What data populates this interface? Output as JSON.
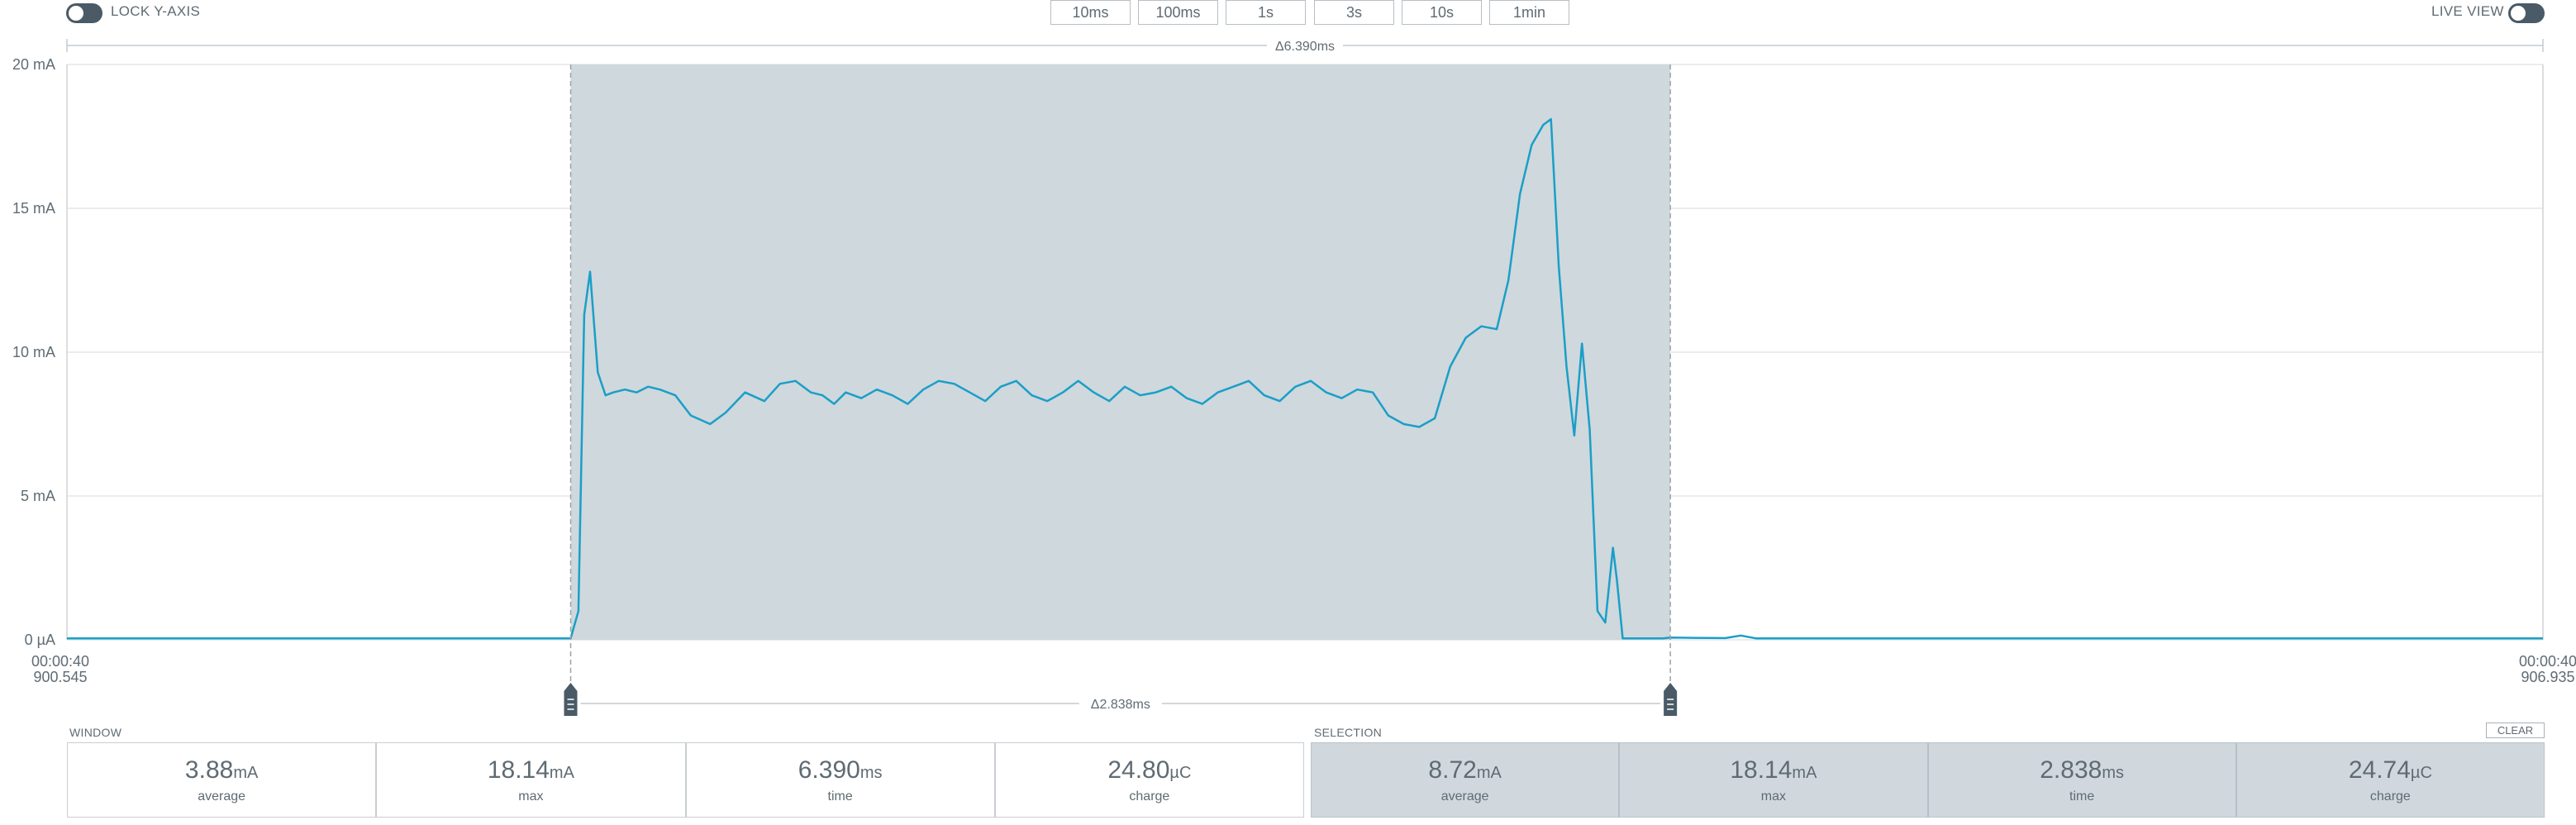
{
  "toolbar": {
    "lock_label": "LOCK Y-AXIS",
    "live_label": "LIVE VIEW",
    "windows": [
      "10ms",
      "100ms",
      "1s",
      "3s",
      "10s",
      "1min"
    ]
  },
  "colors": {
    "line": "#1a9fc7",
    "selection": "#cfd8dd",
    "grid": "#e3e6e8",
    "text": "#5f6b73",
    "marker": "#4a5a66"
  },
  "chart_data": {
    "type": "line",
    "x_unit": "ms",
    "xlim": [
      0,
      6.39
    ],
    "ylim": [
      0,
      20
    ],
    "y_ticks": [
      0,
      5,
      10,
      15,
      20
    ],
    "y_tick_labels": [
      "0 µA",
      "5 mA",
      "10 mA",
      "15 mA",
      "20 mA"
    ],
    "x_start_label": {
      "line1": "00:00:40",
      "line2": "900.545"
    },
    "x_end_label": {
      "line1": "00:00:40",
      "line2": "906.935"
    },
    "window_delta_label": "Δ6.390ms",
    "selection": {
      "start": 1.3,
      "end": 4.138,
      "delta_label": "Δ2.838ms"
    },
    "grid": true,
    "series": [
      {
        "x": [
          0,
          1.3,
          1.32,
          1.335,
          1.35,
          1.37,
          1.39,
          1.41,
          1.44,
          1.47,
          1.5,
          1.53,
          1.57,
          1.61,
          1.66,
          1.7,
          1.75,
          1.8,
          1.84,
          1.88,
          1.92,
          1.95,
          1.98,
          2.01,
          2.05,
          2.09,
          2.13,
          2.17,
          2.21,
          2.25,
          2.29,
          2.33,
          2.37,
          2.41,
          2.45,
          2.49,
          2.53,
          2.57,
          2.61,
          2.65,
          2.69,
          2.73,
          2.77,
          2.81,
          2.85,
          2.89,
          2.93,
          2.97,
          3.01,
          3.05,
          3.09,
          3.13,
          3.17,
          3.21,
          3.25,
          3.29,
          3.33,
          3.37,
          3.41,
          3.45,
          3.49,
          3.53,
          3.57,
          3.61,
          3.65,
          3.69,
          3.72,
          3.75,
          3.78,
          3.81,
          3.83,
          3.85,
          3.87,
          3.89,
          3.91,
          3.93,
          3.95,
          3.97,
          3.99,
          4.0,
          4.015,
          4.03,
          4.045,
          4.06,
          4.075,
          4.09,
          4.105,
          4.12,
          4.138,
          4.2,
          4.28,
          4.32,
          4.36,
          4.4,
          4.5,
          6.39
        ],
        "values": [
          0.05,
          0.05,
          1.0,
          11.3,
          12.8,
          9.3,
          8.5,
          8.6,
          8.7,
          8.6,
          8.8,
          8.7,
          8.5,
          7.8,
          7.5,
          7.9,
          8.6,
          8.3,
          8.9,
          9.0,
          8.6,
          8.5,
          8.2,
          8.6,
          8.4,
          8.7,
          8.5,
          8.2,
          8.7,
          9.0,
          8.9,
          8.6,
          8.3,
          8.8,
          9.0,
          8.5,
          8.3,
          8.6,
          9.0,
          8.6,
          8.3,
          8.8,
          8.5,
          8.6,
          8.8,
          8.4,
          8.2,
          8.6,
          8.8,
          9.0,
          8.5,
          8.3,
          8.8,
          9.0,
          8.6,
          8.4,
          8.7,
          8.6,
          7.8,
          7.5,
          7.4,
          7.7,
          9.5,
          10.5,
          10.9,
          10.8,
          12.5,
          15.5,
          17.2,
          17.9,
          18.1,
          13.0,
          9.5,
          7.1,
          10.3,
          7.3,
          1.0,
          0.6,
          3.2,
          2.1,
          0.05,
          0.05,
          0.05,
          0.05,
          0.05,
          0.05,
          0.05,
          0.05,
          0.08,
          0.07,
          0.06,
          0.15,
          0.05,
          0.05,
          0.05,
          0.05
        ]
      }
    ]
  },
  "window_panel": {
    "title": "WINDOW",
    "stats": [
      {
        "value": "3.88",
        "unit": "mA",
        "label": "average"
      },
      {
        "value": "18.14",
        "unit": "mA",
        "label": "max"
      },
      {
        "value": "6.390",
        "unit": "ms",
        "label": "time"
      },
      {
        "value": "24.80",
        "unit": "µC",
        "label": "charge"
      }
    ]
  },
  "selection_panel": {
    "title": "SELECTION",
    "clear_label": "CLEAR",
    "stats": [
      {
        "value": "8.72",
        "unit": "mA",
        "label": "average"
      },
      {
        "value": "18.14",
        "unit": "mA",
        "label": "max"
      },
      {
        "value": "2.838",
        "unit": "ms",
        "label": "time"
      },
      {
        "value": "24.74",
        "unit": "µC",
        "label": "charge"
      }
    ]
  }
}
